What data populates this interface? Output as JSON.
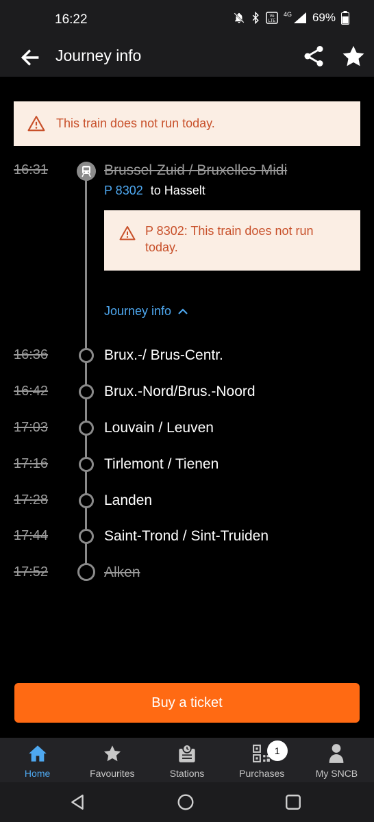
{
  "status_bar": {
    "time": "16:22",
    "network": "4G",
    "battery": "69%"
  },
  "app_bar": {
    "title": "Journey info"
  },
  "top_alert": {
    "text": "This train does not run today."
  },
  "origin": {
    "time": "16:31",
    "station": "Brussel-Zuid / Bruxelles-Midi",
    "train_number": "P 8302",
    "destination": "to Hasselt"
  },
  "inner_alert": {
    "text": "P 8302: This train does not run today."
  },
  "journey_toggle": {
    "label": "Journey info"
  },
  "stops": [
    {
      "time": "16:36",
      "station": "Brux.-/ Brus-Centr."
    },
    {
      "time": "16:42",
      "station": "Brux.-Nord/Brus.-Noord"
    },
    {
      "time": "17:03",
      "station": "Louvain / Leuven"
    },
    {
      "time": "17:16",
      "station": "Tirlemont / Tienen"
    },
    {
      "time": "17:28",
      "station": "Landen"
    },
    {
      "time": "17:44",
      "station": "Saint-Trond / Sint-Truiden"
    },
    {
      "time": "17:52",
      "station": "Alken"
    }
  ],
  "buy_button": {
    "label": "Buy a ticket"
  },
  "bottom_nav": {
    "home": "Home",
    "favourites": "Favourites",
    "stations": "Stations",
    "purchases": "Purchases",
    "purchases_badge": "1",
    "my_sncb": "My SNCB"
  },
  "colors": {
    "accent": "#ff6a13",
    "link": "#4ea8f0",
    "alert_bg": "#fbeee4",
    "alert_text": "#c8502a"
  }
}
